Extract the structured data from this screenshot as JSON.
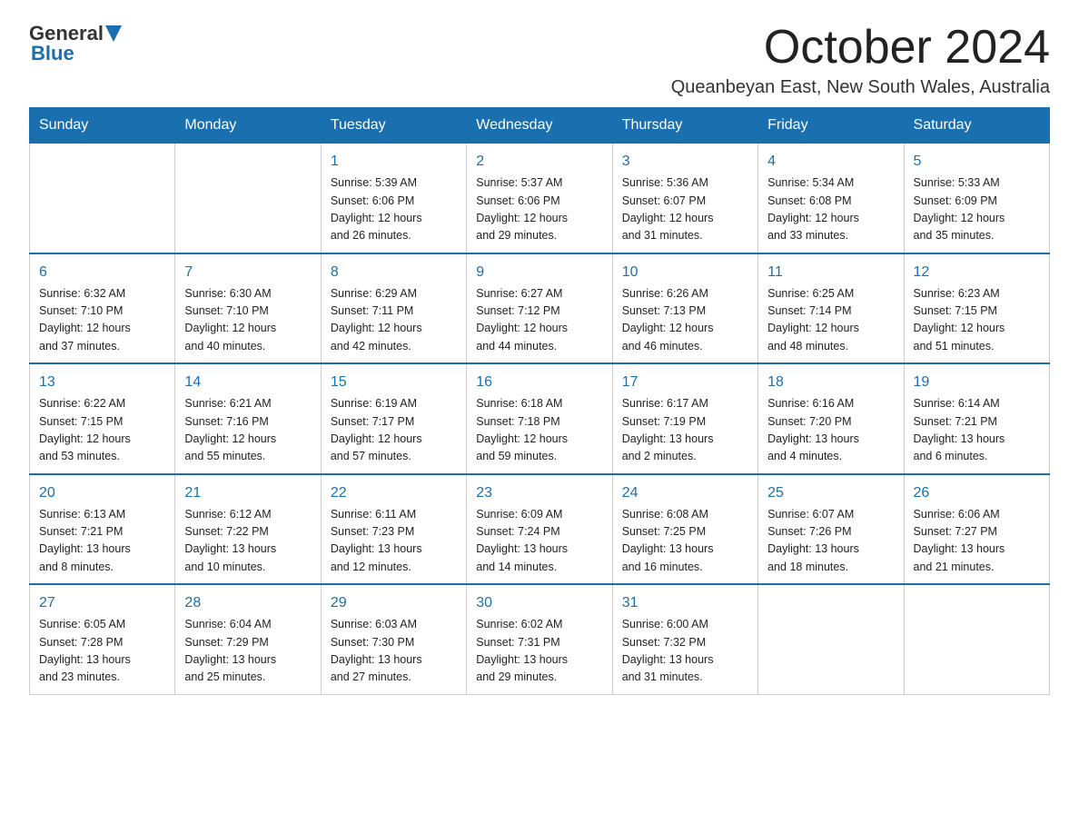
{
  "header": {
    "logo_general": "General",
    "logo_blue": "Blue",
    "title": "October 2024",
    "location": "Queanbeyan East, New South Wales, Australia"
  },
  "days_of_week": [
    "Sunday",
    "Monday",
    "Tuesday",
    "Wednesday",
    "Thursday",
    "Friday",
    "Saturday"
  ],
  "weeks": [
    [
      {
        "day": "",
        "info": ""
      },
      {
        "day": "",
        "info": ""
      },
      {
        "day": "1",
        "info": "Sunrise: 5:39 AM\nSunset: 6:06 PM\nDaylight: 12 hours\nand 26 minutes."
      },
      {
        "day": "2",
        "info": "Sunrise: 5:37 AM\nSunset: 6:06 PM\nDaylight: 12 hours\nand 29 minutes."
      },
      {
        "day": "3",
        "info": "Sunrise: 5:36 AM\nSunset: 6:07 PM\nDaylight: 12 hours\nand 31 minutes."
      },
      {
        "day": "4",
        "info": "Sunrise: 5:34 AM\nSunset: 6:08 PM\nDaylight: 12 hours\nand 33 minutes."
      },
      {
        "day": "5",
        "info": "Sunrise: 5:33 AM\nSunset: 6:09 PM\nDaylight: 12 hours\nand 35 minutes."
      }
    ],
    [
      {
        "day": "6",
        "info": "Sunrise: 6:32 AM\nSunset: 7:10 PM\nDaylight: 12 hours\nand 37 minutes."
      },
      {
        "day": "7",
        "info": "Sunrise: 6:30 AM\nSunset: 7:10 PM\nDaylight: 12 hours\nand 40 minutes."
      },
      {
        "day": "8",
        "info": "Sunrise: 6:29 AM\nSunset: 7:11 PM\nDaylight: 12 hours\nand 42 minutes."
      },
      {
        "day": "9",
        "info": "Sunrise: 6:27 AM\nSunset: 7:12 PM\nDaylight: 12 hours\nand 44 minutes."
      },
      {
        "day": "10",
        "info": "Sunrise: 6:26 AM\nSunset: 7:13 PM\nDaylight: 12 hours\nand 46 minutes."
      },
      {
        "day": "11",
        "info": "Sunrise: 6:25 AM\nSunset: 7:14 PM\nDaylight: 12 hours\nand 48 minutes."
      },
      {
        "day": "12",
        "info": "Sunrise: 6:23 AM\nSunset: 7:15 PM\nDaylight: 12 hours\nand 51 minutes."
      }
    ],
    [
      {
        "day": "13",
        "info": "Sunrise: 6:22 AM\nSunset: 7:15 PM\nDaylight: 12 hours\nand 53 minutes."
      },
      {
        "day": "14",
        "info": "Sunrise: 6:21 AM\nSunset: 7:16 PM\nDaylight: 12 hours\nand 55 minutes."
      },
      {
        "day": "15",
        "info": "Sunrise: 6:19 AM\nSunset: 7:17 PM\nDaylight: 12 hours\nand 57 minutes."
      },
      {
        "day": "16",
        "info": "Sunrise: 6:18 AM\nSunset: 7:18 PM\nDaylight: 12 hours\nand 59 minutes."
      },
      {
        "day": "17",
        "info": "Sunrise: 6:17 AM\nSunset: 7:19 PM\nDaylight: 13 hours\nand 2 minutes."
      },
      {
        "day": "18",
        "info": "Sunrise: 6:16 AM\nSunset: 7:20 PM\nDaylight: 13 hours\nand 4 minutes."
      },
      {
        "day": "19",
        "info": "Sunrise: 6:14 AM\nSunset: 7:21 PM\nDaylight: 13 hours\nand 6 minutes."
      }
    ],
    [
      {
        "day": "20",
        "info": "Sunrise: 6:13 AM\nSunset: 7:21 PM\nDaylight: 13 hours\nand 8 minutes."
      },
      {
        "day": "21",
        "info": "Sunrise: 6:12 AM\nSunset: 7:22 PM\nDaylight: 13 hours\nand 10 minutes."
      },
      {
        "day": "22",
        "info": "Sunrise: 6:11 AM\nSunset: 7:23 PM\nDaylight: 13 hours\nand 12 minutes."
      },
      {
        "day": "23",
        "info": "Sunrise: 6:09 AM\nSunset: 7:24 PM\nDaylight: 13 hours\nand 14 minutes."
      },
      {
        "day": "24",
        "info": "Sunrise: 6:08 AM\nSunset: 7:25 PM\nDaylight: 13 hours\nand 16 minutes."
      },
      {
        "day": "25",
        "info": "Sunrise: 6:07 AM\nSunset: 7:26 PM\nDaylight: 13 hours\nand 18 minutes."
      },
      {
        "day": "26",
        "info": "Sunrise: 6:06 AM\nSunset: 7:27 PM\nDaylight: 13 hours\nand 21 minutes."
      }
    ],
    [
      {
        "day": "27",
        "info": "Sunrise: 6:05 AM\nSunset: 7:28 PM\nDaylight: 13 hours\nand 23 minutes."
      },
      {
        "day": "28",
        "info": "Sunrise: 6:04 AM\nSunset: 7:29 PM\nDaylight: 13 hours\nand 25 minutes."
      },
      {
        "day": "29",
        "info": "Sunrise: 6:03 AM\nSunset: 7:30 PM\nDaylight: 13 hours\nand 27 minutes."
      },
      {
        "day": "30",
        "info": "Sunrise: 6:02 AM\nSunset: 7:31 PM\nDaylight: 13 hours\nand 29 minutes."
      },
      {
        "day": "31",
        "info": "Sunrise: 6:00 AM\nSunset: 7:32 PM\nDaylight: 13 hours\nand 31 minutes."
      },
      {
        "day": "",
        "info": ""
      },
      {
        "day": "",
        "info": ""
      }
    ]
  ]
}
